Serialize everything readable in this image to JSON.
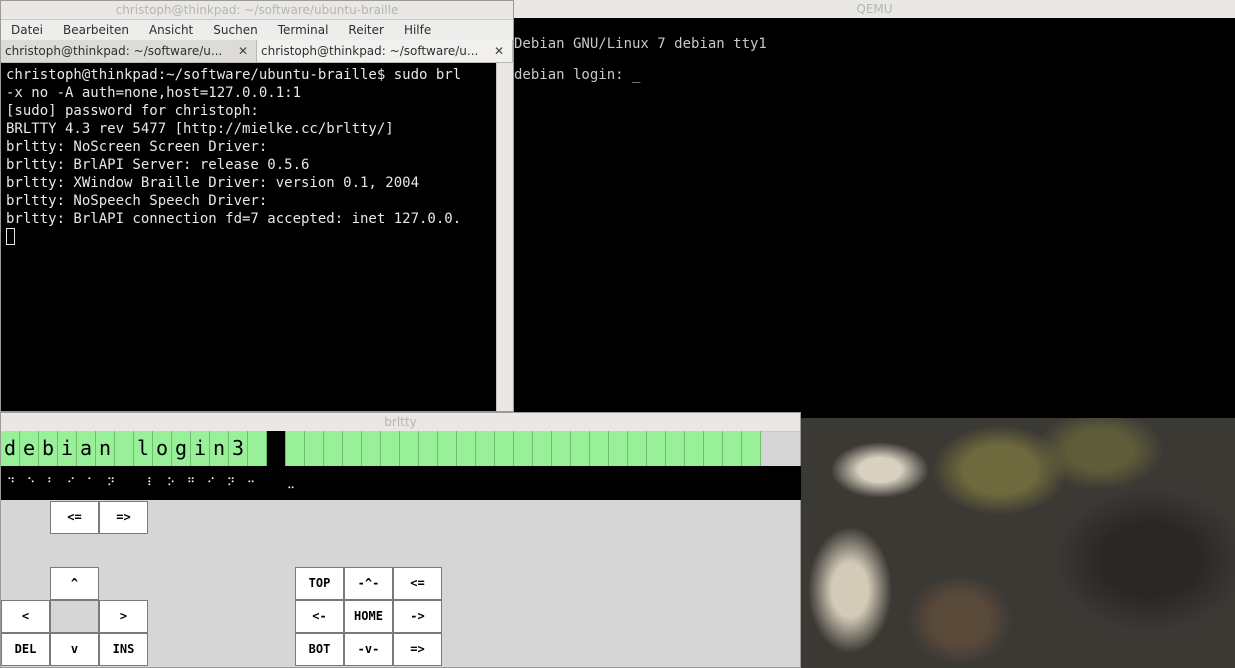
{
  "terminal": {
    "title": "christoph@thinkpad: ~/software/ubuntu-braille",
    "menu": [
      "Datei",
      "Bearbeiten",
      "Ansicht",
      "Suchen",
      "Terminal",
      "Reiter",
      "Hilfe"
    ],
    "tabs": [
      {
        "label": "christoph@thinkpad: ~/software/u...",
        "close": "✕"
      },
      {
        "label": "christoph@thinkpad: ~/software/u...",
        "close": "✕"
      }
    ],
    "lines": [
      "christoph@thinkpad:~/software/ubuntu-braille$ sudo brl",
      "-x no -A auth=none,host=127.0.0.1:1",
      "[sudo] password for christoph:",
      "BRLTTY 4.3 rev 5477 [http://mielke.cc/brltty/]",
      "brltty: NoScreen Screen Driver:",
      "brltty: BrlAPI Server: release 0.5.6",
      "brltty: XWindow Braille Driver: version 0.1, 2004",
      "brltty: NoSpeech Speech Driver:",
      "brltty: BrlAPI connection fd=7 accepted: inet 127.0.0."
    ]
  },
  "qemu": {
    "title": "QEMU",
    "lines": [
      "Debian GNU/Linux 7 debian tty1",
      "debian login: _"
    ]
  },
  "brltty": {
    "title": "brltty",
    "cells": [
      "d",
      "e",
      "b",
      "i",
      "a",
      "n",
      " ",
      "l",
      "o",
      "g",
      "i",
      "n",
      "3"
    ],
    "cursor_index": 14,
    "total_cells": 40,
    "dots": [
      "⠙",
      "⠑",
      "⠃",
      "⠊",
      "⠁",
      "⠝",
      " ",
      "⠇",
      "⠕",
      "⠛",
      "⠊",
      "⠝",
      "⠒",
      " ",
      "⣀"
    ],
    "buttons": {
      "win_left": "<=",
      "win_right": "=>",
      "up": "^",
      "left": "<",
      "right": ">",
      "del": "DEL",
      "down": "v",
      "ins": "INS",
      "top": "TOP",
      "prev_line": "-^-",
      "back": "<=",
      "left_arrow": "<-",
      "home": "HOME",
      "right_arrow": "->",
      "bot": "BOT",
      "next_line": "-v-",
      "fwd": "=>"
    }
  }
}
